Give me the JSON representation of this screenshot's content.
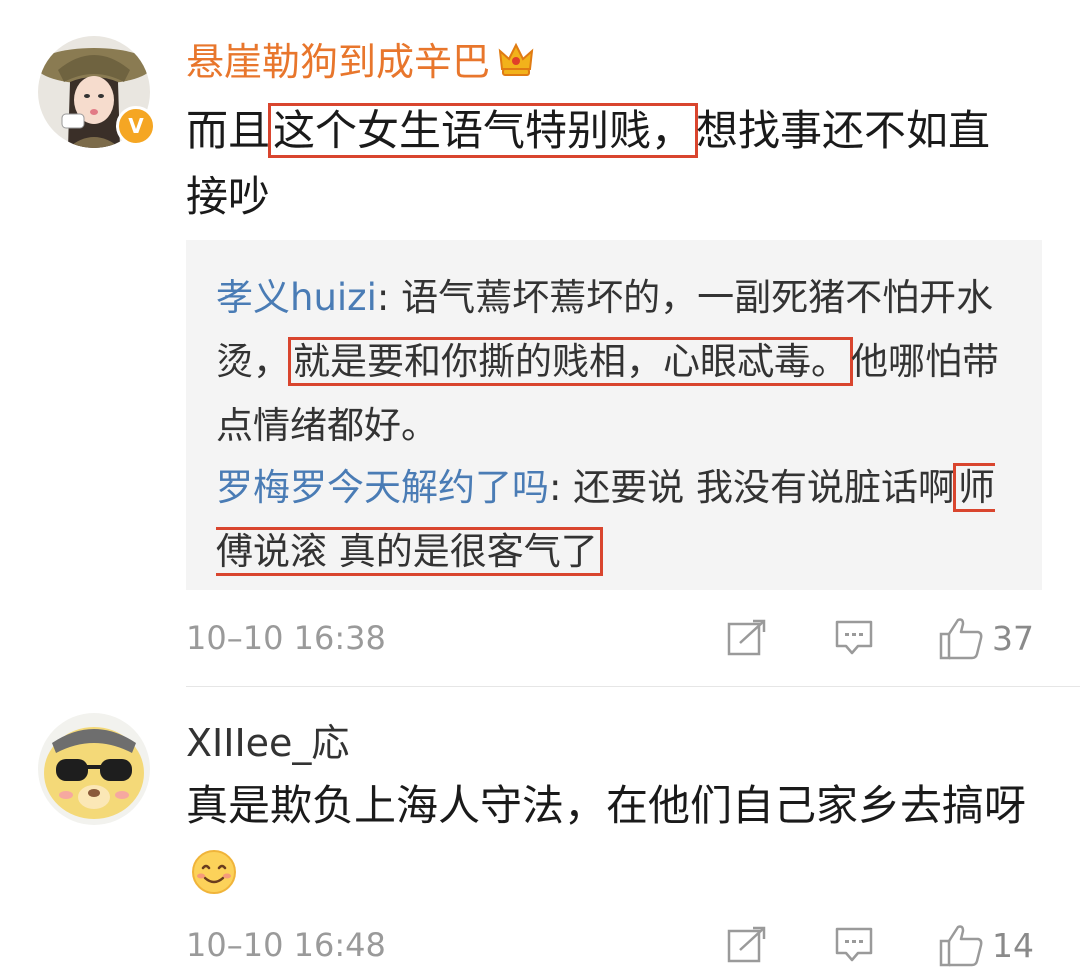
{
  "comments": [
    {
      "username": "悬崖勒狗到成辛巴",
      "badge": "V",
      "text_before": "而且",
      "text_highlight": "这个女生语气特别贱，",
      "text_after": "想找事还不如直接吵",
      "replies": [
        {
          "name": "孝义huizi",
          "sep": ": ",
          "text_before": "语气蔫坏蔫坏的，一副死猪不怕开水烫，",
          "text_highlight": "就是要和你撕的贱相，心眼忒毒。",
          "text_after": "他哪怕带点情绪都好。"
        },
        {
          "name": "罗梅罗今天解约了吗",
          "sep": ": ",
          "text_before": "还要说 我没有说脏话啊",
          "text_highlight": "师傅说滚 真的是很客气了",
          "text_after": ""
        }
      ],
      "time": "10–10 16:38",
      "likes": "37"
    },
    {
      "username": "XIIIee_応",
      "text": "真是欺负上海人守法，在他们自己家乡去搞呀",
      "emoji": "smile-emoji",
      "time": "10–10 16:48",
      "likes": "14"
    }
  ],
  "icons": [
    "crown-icon",
    "verified-icon",
    "share-icon",
    "reply-icon",
    "like-icon",
    "smile-emoji"
  ],
  "colors": {
    "vip_name": "#e8762c",
    "reply_name": "#4a7cb5",
    "highlight_border": "#d9452e",
    "badge": "#f5a623",
    "reply_bg": "#f4f4f4",
    "meta": "#9a9a9a"
  }
}
